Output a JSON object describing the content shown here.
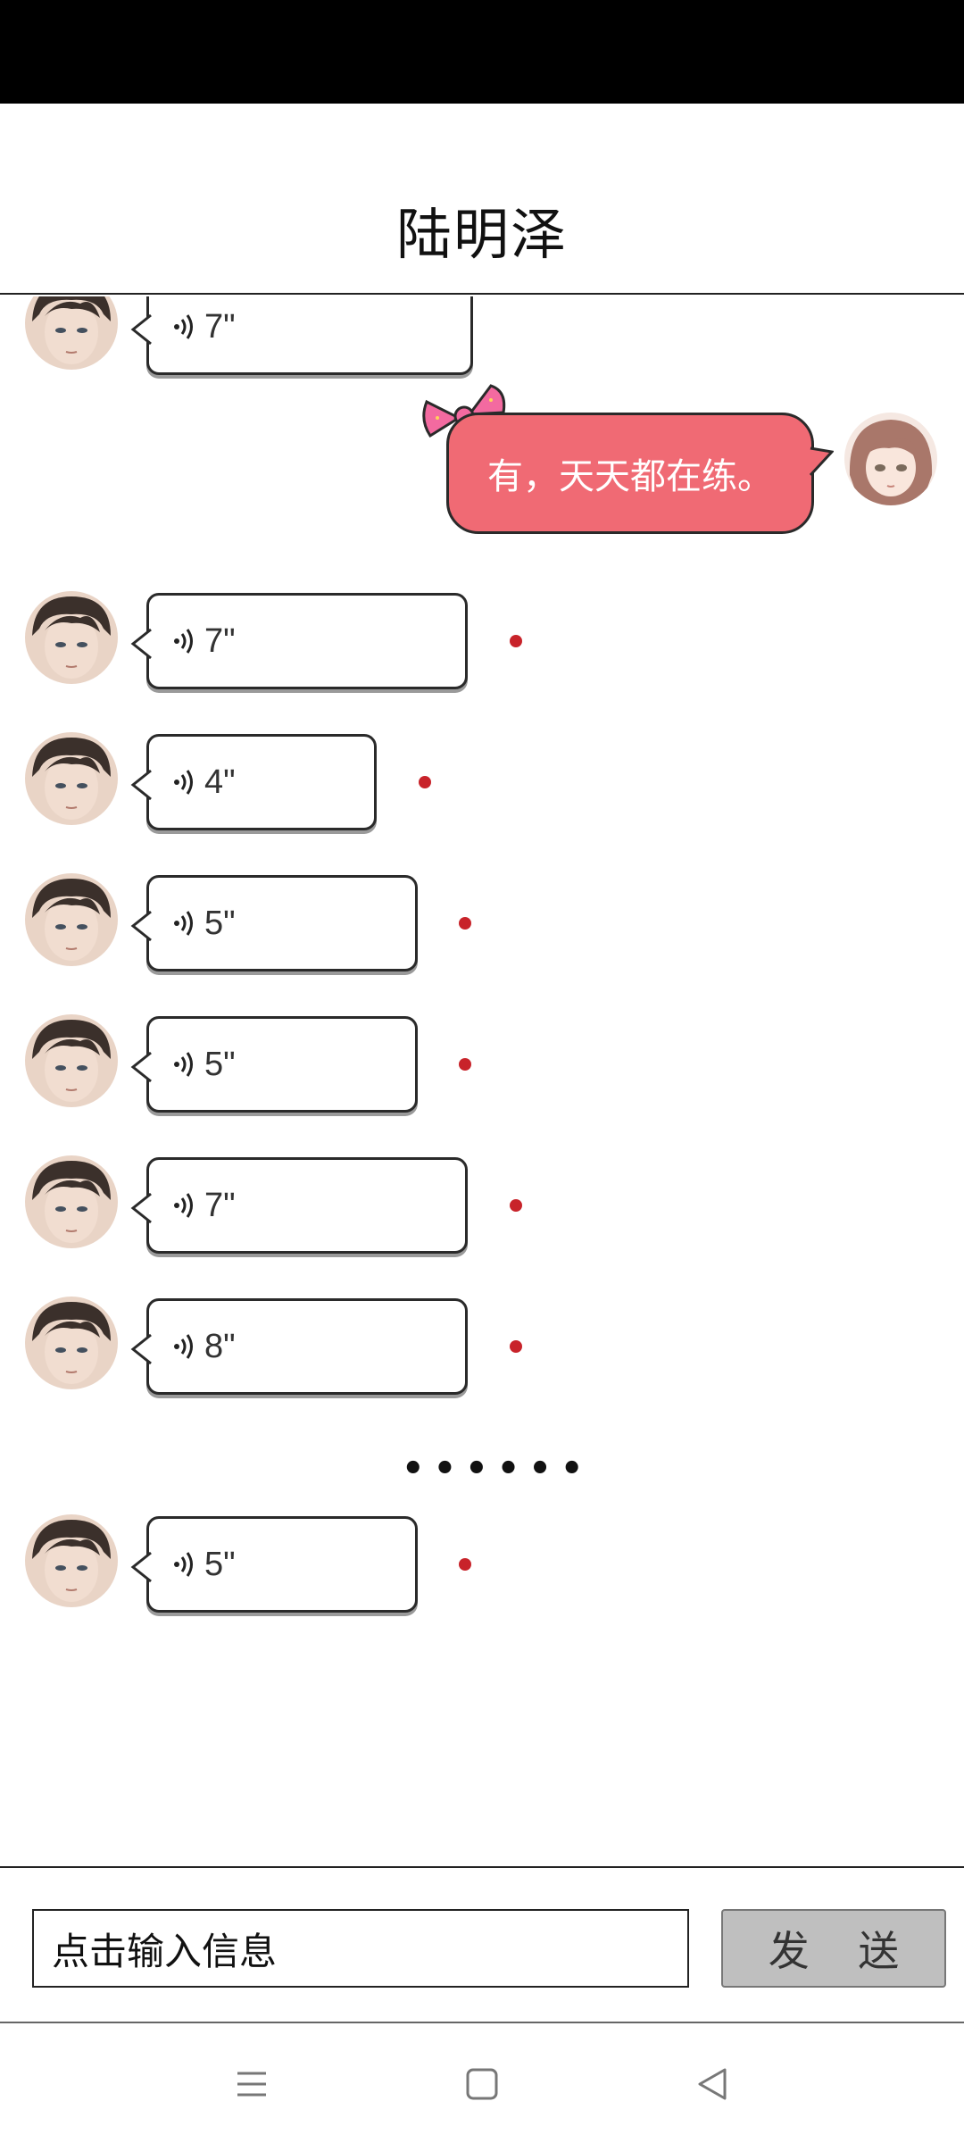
{
  "header": {
    "title": "陆明泽"
  },
  "messages": [
    {
      "sender": "male",
      "duration": "7\"",
      "unread": false
    },
    {
      "sender": "female",
      "text": "有，天天都在练。"
    },
    {
      "sender": "male",
      "duration": "7\"",
      "unread": true
    },
    {
      "sender": "male",
      "duration": "4\"",
      "unread": true
    },
    {
      "sender": "male",
      "duration": "5\"",
      "unread": true
    },
    {
      "sender": "male",
      "duration": "5\"",
      "unread": true
    },
    {
      "sender": "male",
      "duration": "7\"",
      "unread": true
    },
    {
      "sender": "male",
      "duration": "8\"",
      "unread": true
    },
    {
      "sender": "male",
      "duration": "5\"",
      "unread": true
    }
  ],
  "separator": "••••••",
  "input": {
    "placeholder": "点击输入信息",
    "send_label": "发 送"
  },
  "nav": {
    "icons": [
      "menu-icon",
      "home-icon",
      "back-icon"
    ]
  },
  "colors": {
    "pink_bubble": "#f06a74",
    "unread_dot": "#c8232a",
    "send_bg": "#bfbfbf"
  }
}
